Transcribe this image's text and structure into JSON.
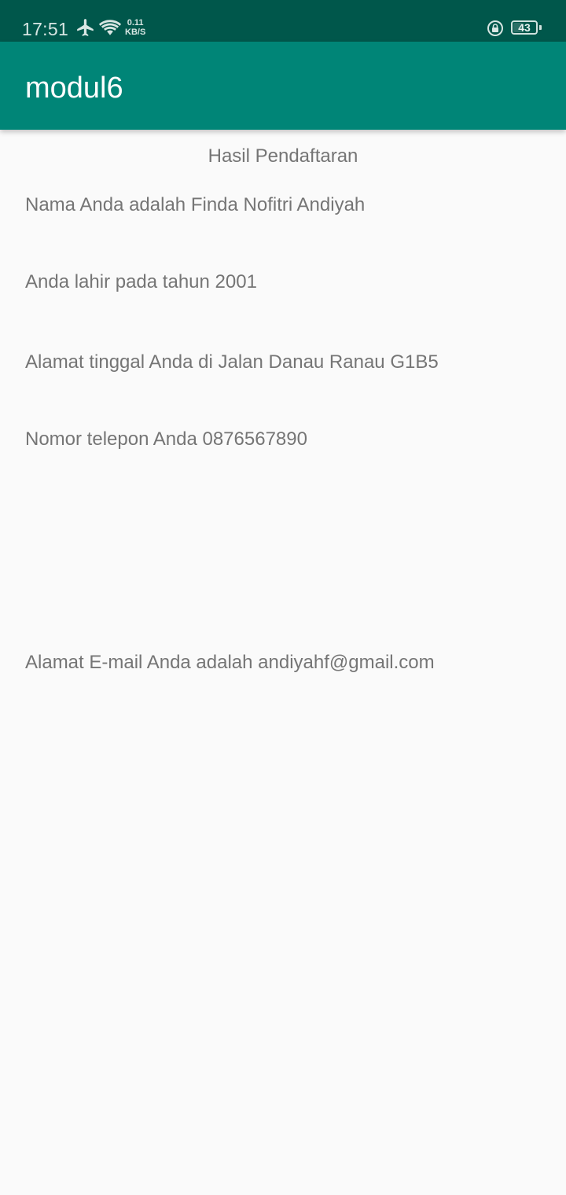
{
  "status_bar": {
    "time": "17:51",
    "net_speed_value": "0.11",
    "net_speed_unit": "KB/S",
    "battery_level": "43",
    "battery_fraction": 0.43,
    "icons": [
      "airplane-icon",
      "wifi-icon",
      "rotation-lock-icon",
      "battery-icon"
    ]
  },
  "app_bar": {
    "title": "modul6",
    "color": "#008577",
    "status_color": "#00574b"
  },
  "result": {
    "title": "Hasil Pendaftaran",
    "name_line": "Nama Anda adalah Finda Nofitri Andiyah",
    "birth_line": "Anda lahir pada tahun 2001",
    "address_line": "Alamat tinggal Anda di Jalan Danau Ranau G1B5",
    "phone_line": "Nomor telepon Anda 0876567890",
    "email_line": "Alamat E-mail Anda adalah andiyahf@gmail.com"
  }
}
